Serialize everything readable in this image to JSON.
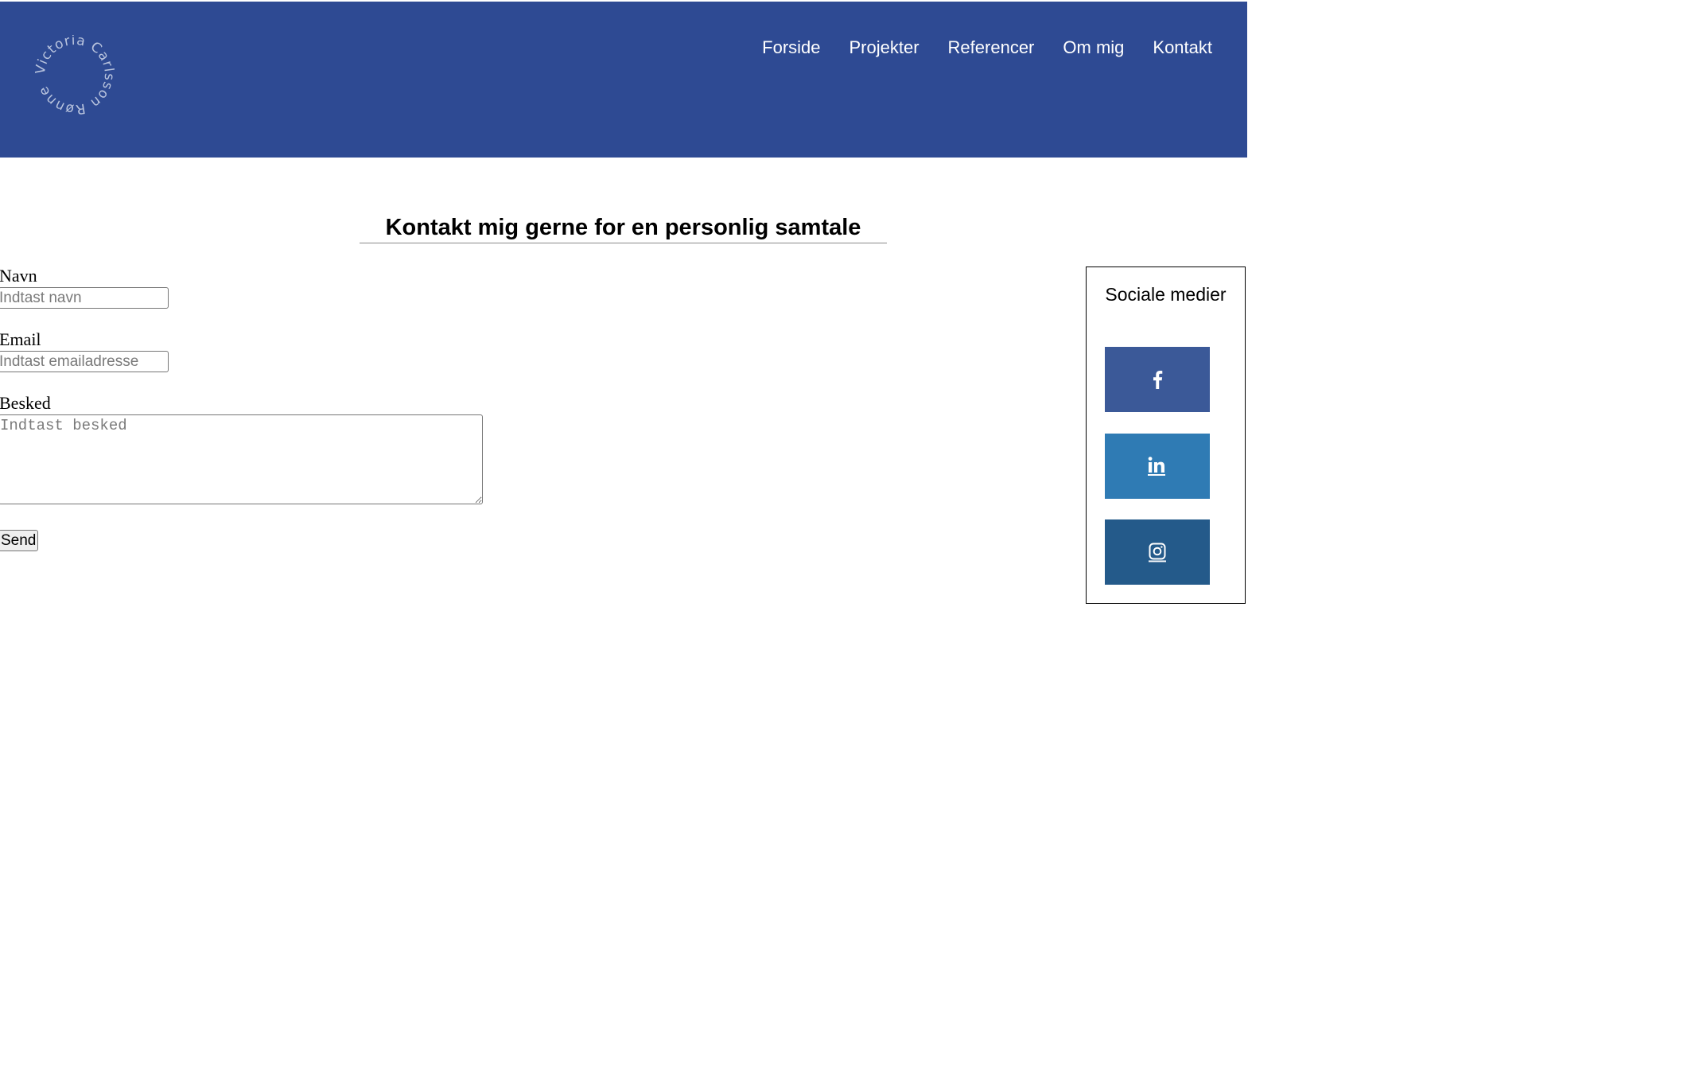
{
  "header": {
    "logo_text": "Victoria Carlsson Rønne",
    "colors": {
      "background": "#2e4a93",
      "nav_text": "#ffffff"
    },
    "nav": [
      {
        "label": "Forside"
      },
      {
        "label": "Projekter"
      },
      {
        "label": "Referencer"
      },
      {
        "label": "Om mig"
      },
      {
        "label": "Kontakt"
      }
    ]
  },
  "main": {
    "heading": "Kontakt mig gerne for en personlig samtale"
  },
  "form": {
    "name": {
      "label": "Navn",
      "placeholder": "Indtast navn",
      "value": ""
    },
    "email": {
      "label": "Email",
      "placeholder": "Indtast emailadresse",
      "value": ""
    },
    "message": {
      "label": "Besked",
      "placeholder": "Indtast besked",
      "value": ""
    },
    "submit_label": "Send"
  },
  "social": {
    "title": "Sociale medier",
    "links": [
      {
        "icon": "facebook-icon",
        "color": "#3b5998"
      },
      {
        "icon": "linkedin-icon",
        "color": "#2f7bb4"
      },
      {
        "icon": "instagram-icon",
        "color": "#245a8a"
      }
    ]
  }
}
